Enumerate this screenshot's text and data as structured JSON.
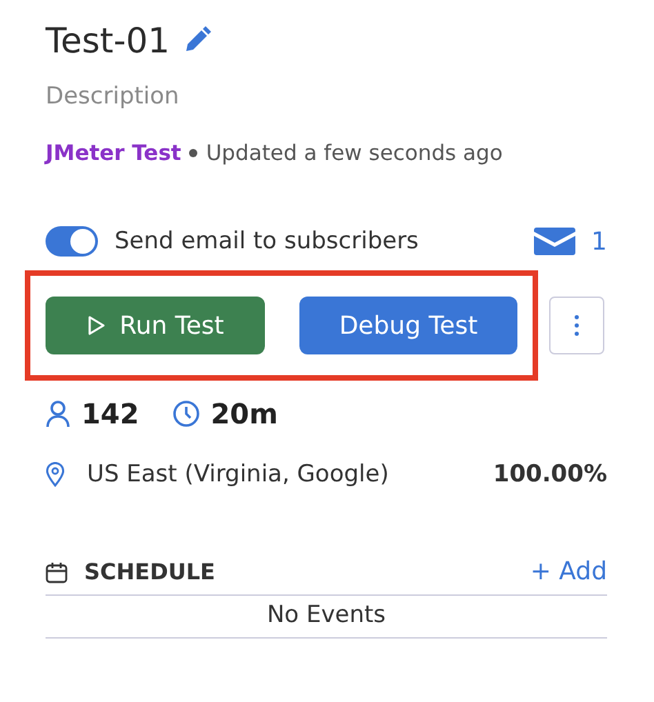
{
  "title": "Test-01",
  "description": {
    "placeholder": "Description"
  },
  "meta": {
    "test_type": "JMeter Test",
    "updated": "Updated a few seconds ago"
  },
  "notifications": {
    "label": "Send email to subscribers",
    "on": true,
    "subscriber_count": "1"
  },
  "actions": [
    {
      "label": "Run Test",
      "kind": "run"
    },
    {
      "label": "Debug Test",
      "kind": "debug"
    }
  ],
  "stats": {
    "users": "142",
    "duration": "20m"
  },
  "locations": [
    {
      "name": "US East (Virginia, Google)",
      "share": "100.00%"
    }
  ],
  "schedule": {
    "title": "SCHEDULE",
    "add": "+ Add",
    "empty": "No Events"
  }
}
